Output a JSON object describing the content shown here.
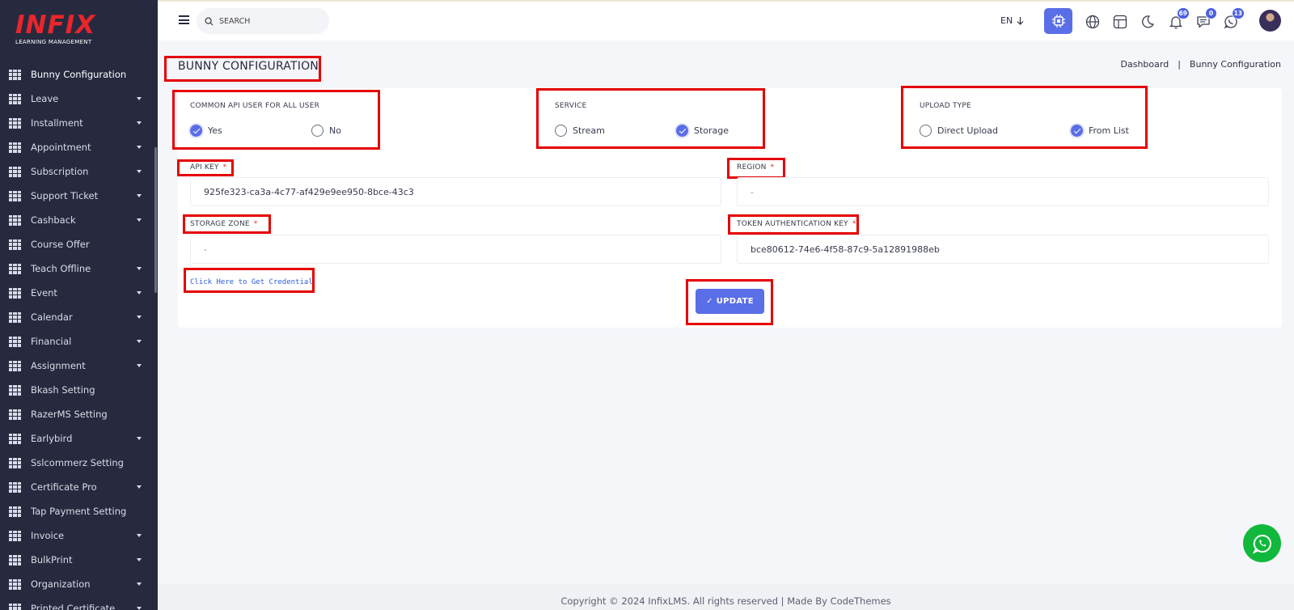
{
  "brand": {
    "name": "INFIX",
    "subtitle": "LEARNING MANAGEMENT"
  },
  "sidebar": {
    "items": [
      {
        "label": "Bunny Configuration",
        "active": true,
        "has_caret": false
      },
      {
        "label": "Leave",
        "has_caret": true
      },
      {
        "label": "Installment",
        "has_caret": true
      },
      {
        "label": "Appointment",
        "has_caret": true
      },
      {
        "label": "Subscription",
        "has_caret": true
      },
      {
        "label": "Support Ticket",
        "has_caret": true
      },
      {
        "label": "Cashback",
        "has_caret": true
      },
      {
        "label": "Course Offer",
        "has_caret": false
      },
      {
        "label": "Teach Offline",
        "has_caret": true
      },
      {
        "label": "Event",
        "has_caret": true
      },
      {
        "label": "Calendar",
        "has_caret": true
      },
      {
        "label": "Financial",
        "has_caret": true
      },
      {
        "label": "Assignment",
        "has_caret": true
      },
      {
        "label": "Bkash Setting",
        "has_caret": false
      },
      {
        "label": "RazerMS Setting",
        "has_caret": false
      },
      {
        "label": "Earlybird",
        "has_caret": true
      },
      {
        "label": "Sslcommerz Setting",
        "has_caret": false
      },
      {
        "label": "Certificate Pro",
        "has_caret": true
      },
      {
        "label": "Tap Payment Setting",
        "has_caret": false
      },
      {
        "label": "Invoice",
        "has_caret": true
      },
      {
        "label": "BulkPrint",
        "has_caret": true
      },
      {
        "label": "Organization",
        "has_caret": true
      },
      {
        "label": "Printed Certificate",
        "has_caret": true
      }
    ]
  },
  "topbar": {
    "search_placeholder": "SEARCH",
    "language": "EN",
    "badges": {
      "notifications": "69",
      "messages": "0",
      "whatsapp": "13"
    }
  },
  "page": {
    "title": "BUNNY CONFIGURATION",
    "breadcrumb": [
      "Dashboard",
      "|",
      "Bunny Configuration"
    ]
  },
  "form": {
    "common_api": {
      "title": "COMMON API USER FOR ALL USER",
      "options": [
        "Yes",
        "No"
      ],
      "selected": "Yes"
    },
    "service": {
      "title": "SERVICE",
      "options": [
        "Stream",
        "Storage"
      ],
      "selected": "Storage"
    },
    "upload_type": {
      "title": "UPLOAD TYPE",
      "options": [
        "Direct Upload",
        "From List"
      ],
      "selected": "From List"
    },
    "api_key": {
      "label": "API KEY",
      "required": "*",
      "value": "925fe323-ca3a-4c77-af429e9ee950-8bce-43c3"
    },
    "region": {
      "label": "REGION",
      "required": "*",
      "value": "",
      "placeholder": "-"
    },
    "storage_zone": {
      "label": "STORAGE ZONE",
      "required": "*",
      "value": "",
      "placeholder": "-"
    },
    "token_key": {
      "label": "TOKEN AUTHENTICATION KEY",
      "required": "*",
      "value": "bce80612-74e6-4f58-87c9-5a12891988eb"
    },
    "credential_link": "Click Here to Get Credential",
    "update_label": "UPDATE",
    "update_check": "✓"
  },
  "footer": {
    "text": "Copyright © 2024 InfixLMS. All rights reserved | Made By CodeThemes"
  },
  "colors": {
    "sidebar_bg": "#272a3f",
    "accent": "#5a6ee8",
    "brand_red": "#e8262b",
    "highlight": "#e50000",
    "whatsapp": "#12b83c"
  }
}
